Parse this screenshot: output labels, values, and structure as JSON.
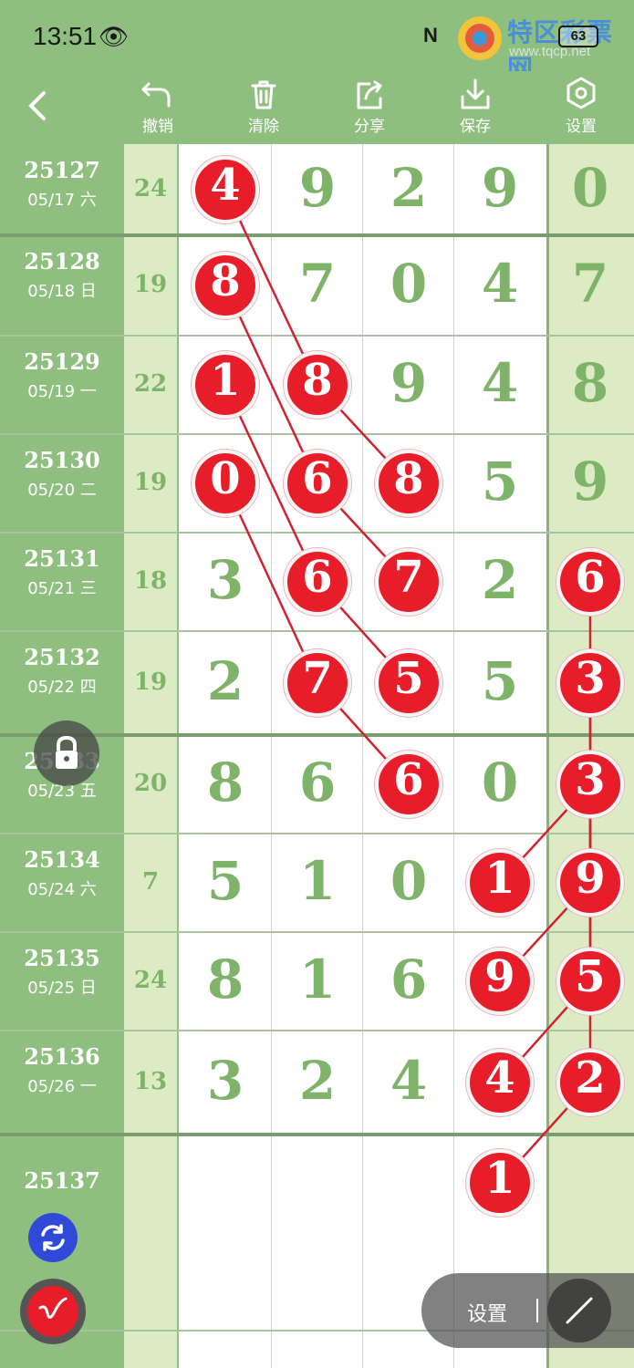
{
  "status_bar": {
    "time": "13:51",
    "battery": "63",
    "nfc": "N"
  },
  "watermark": {
    "title": "特区彩票网",
    "url": "www.tqcp.net"
  },
  "toolbar": {
    "back_icon": "chevron-left-icon",
    "undo_label": "撤销",
    "clear_label": "清除",
    "share_label": "分享",
    "save_label": "保存",
    "settings_label": "设置"
  },
  "rows": [
    {
      "issue": "25127",
      "date": "05/17 六",
      "sum": "24",
      "d": [
        "4",
        "9",
        "2",
        "9",
        "0"
      ]
    },
    {
      "issue": "25128",
      "date": "05/18 日",
      "sum": "19",
      "d": [
        "8",
        "7",
        "0",
        "4",
        "7"
      ]
    },
    {
      "issue": "25129",
      "date": "05/19 一",
      "sum": "22",
      "d": [
        "1",
        "8",
        "9",
        "4",
        "8"
      ]
    },
    {
      "issue": "25130",
      "date": "05/20 二",
      "sum": "19",
      "d": [
        "0",
        "6",
        "8",
        "5",
        "9"
      ]
    },
    {
      "issue": "25131",
      "date": "05/21 三",
      "sum": "18",
      "d": [
        "3",
        "6",
        "7",
        "2",
        "6"
      ]
    },
    {
      "issue": "25132",
      "date": "05/22 四",
      "sum": "19",
      "d": [
        "2",
        "7",
        "5",
        "5",
        "3"
      ]
    },
    {
      "issue": "25133",
      "date": "05/23 五",
      "sum": "20",
      "d": [
        "8",
        "6",
        "6",
        "0",
        "3"
      ]
    },
    {
      "issue": "25134",
      "date": "05/24 六",
      "sum": "7",
      "d": [
        "5",
        "1",
        "0",
        "1",
        "9"
      ]
    },
    {
      "issue": "25135",
      "date": "05/25 日",
      "sum": "24",
      "d": [
        "8",
        "1",
        "6",
        "9",
        "5"
      ]
    },
    {
      "issue": "25136",
      "date": "05/26 一",
      "sum": "13",
      "d": [
        "3",
        "2",
        "4",
        "4",
        "2"
      ]
    },
    {
      "issue": "25137",
      "date": "",
      "sum": "",
      "d": [
        "",
        "",
        "",
        "1",
        ""
      ]
    }
  ],
  "circled": [
    [
      0,
      0
    ],
    [
      1,
      0
    ],
    [
      2,
      0
    ],
    [
      3,
      0
    ],
    [
      2,
      1
    ],
    [
      3,
      1
    ],
    [
      4,
      1
    ],
    [
      5,
      1
    ],
    [
      3,
      2
    ],
    [
      4,
      2
    ],
    [
      5,
      2
    ],
    [
      6,
      2
    ],
    [
      7,
      3
    ],
    [
      8,
      3
    ],
    [
      9,
      3
    ],
    [
      10,
      3
    ],
    [
      4,
      4
    ],
    [
      5,
      4
    ],
    [
      6,
      4
    ],
    [
      7,
      4
    ],
    [
      8,
      4
    ],
    [
      9,
      4
    ]
  ],
  "colors": {
    "bg": "#8fbf7e",
    "pale": "#ddebc4",
    "digit": "#7fb36a",
    "circle": "#e81d2a",
    "line": "#d0232f"
  },
  "float_panel": {
    "settings_label": "设置"
  },
  "floating_buttons": {
    "lock": "lock-icon",
    "refresh": "refresh-icon",
    "pen": "pen-icon",
    "draw": "line-tool-icon"
  }
}
